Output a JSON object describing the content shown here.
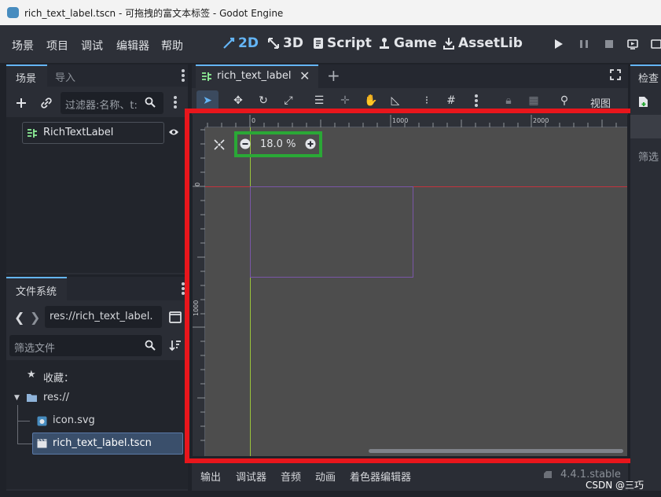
{
  "window": {
    "title": "rich_text_label.tscn - 可拖拽的富文本标签 - Godot Engine"
  },
  "menu": {
    "items": [
      "场景",
      "项目",
      "调试",
      "编辑器",
      "帮助"
    ]
  },
  "workspaces": [
    "2D",
    "3D",
    "Script",
    "Game",
    "AssetLib"
  ],
  "scene_dock": {
    "tabs": [
      "场景",
      "导入"
    ],
    "filter_placeholder": "过滤器:名称、t:",
    "root_node": "RichTextLabel"
  },
  "filesystem_dock": {
    "tab": "文件系统",
    "path": "res://rich_text_label.",
    "filter_placeholder": "筛选文件",
    "favorites_label": "收藏：",
    "root": "res://",
    "files": [
      "icon.svg",
      "rich_text_label.tscn"
    ]
  },
  "editor": {
    "tab_label": "rich_text_label",
    "view_menu": "视图",
    "zoom": "18.0 %",
    "ruler_h": [
      "0",
      "1000",
      "2000"
    ],
    "ruler_v": [
      "0",
      "1000"
    ]
  },
  "inspector": {
    "tab": "检查",
    "filter": "筛选"
  },
  "bottom_panel": {
    "tabs": [
      "输出",
      "调试器",
      "音频",
      "动画",
      "着色器编辑器"
    ],
    "version": "4.4.1.stable"
  },
  "watermark": "CSDN @三巧",
  "colors": {
    "accent": "#64b5f6",
    "highlight_red": "#e8161c",
    "highlight_green": "#2aa836",
    "node_green": "#8eef97"
  }
}
